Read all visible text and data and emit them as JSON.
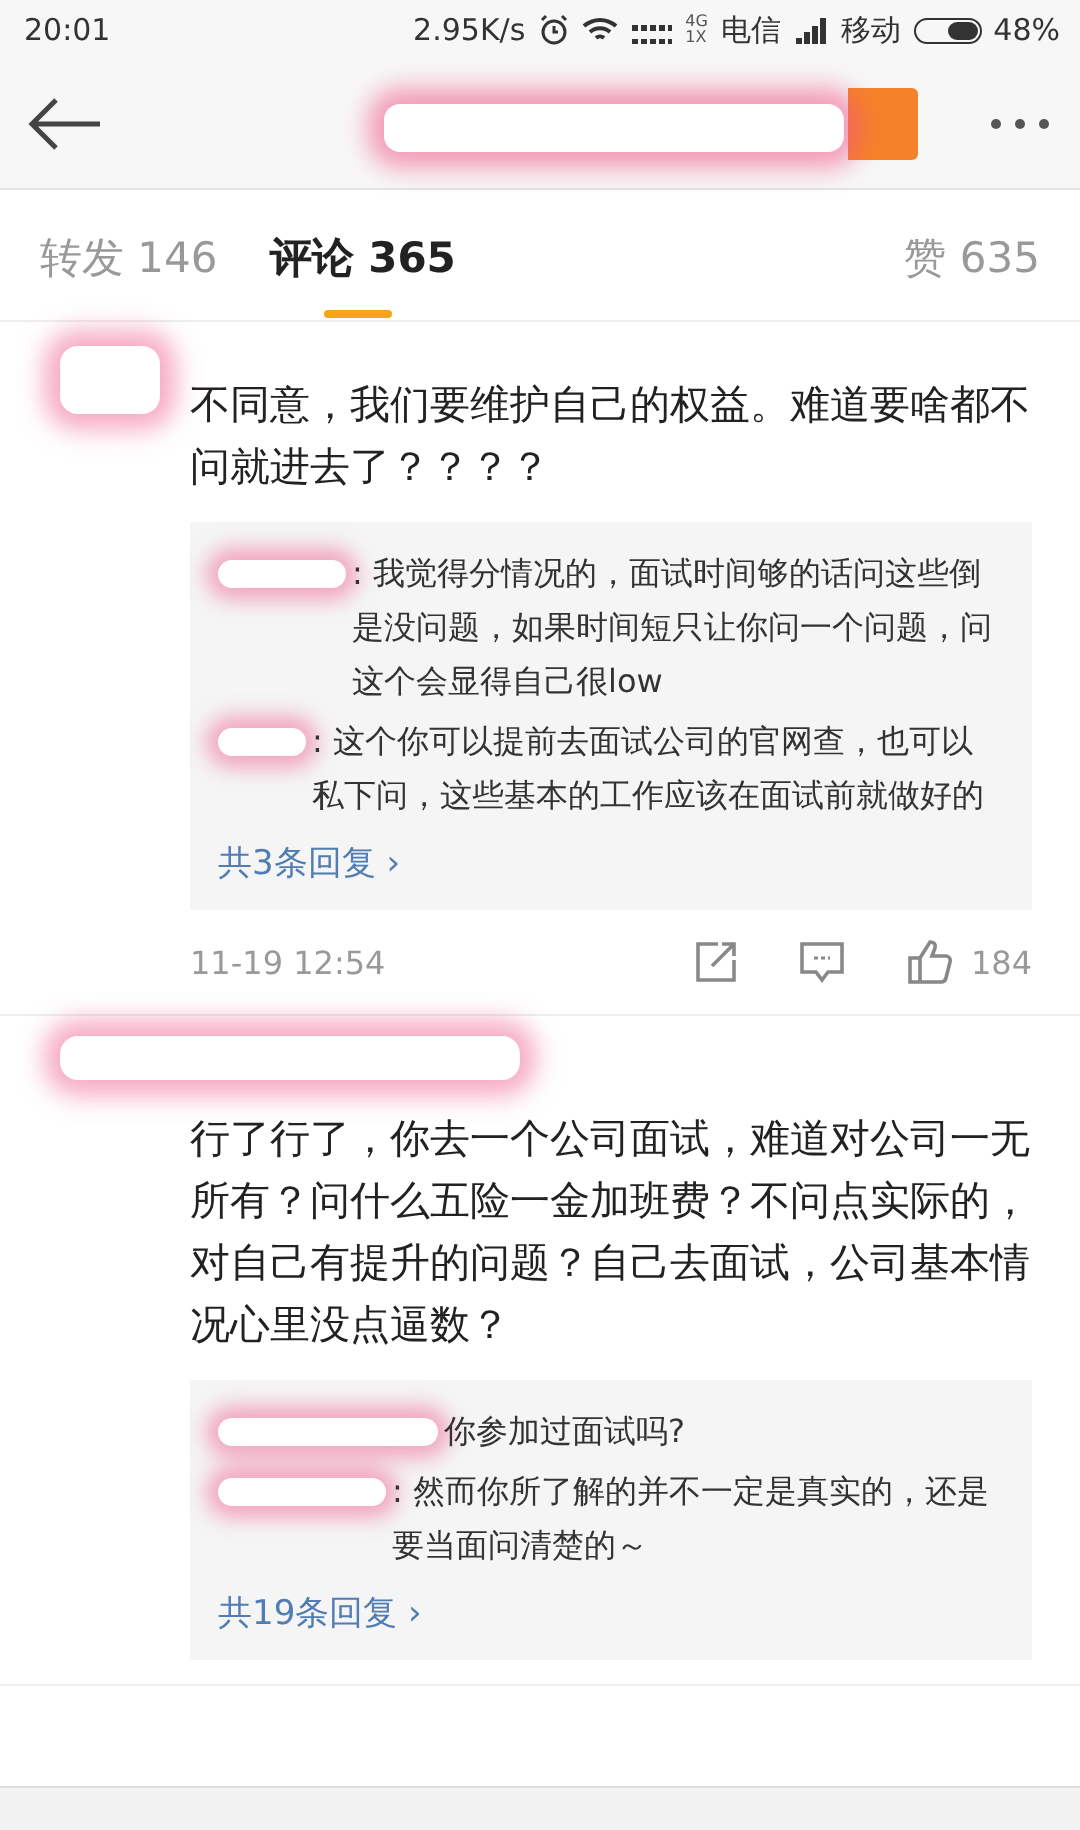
{
  "status_bar": {
    "time": "20:01",
    "speed": "2.95K/s",
    "network_type": "4G 1X",
    "carrier_1": "电信",
    "carrier_2": "移动",
    "battery": "48%"
  },
  "tabs": [
    {
      "label": "转发 146",
      "selected": false
    },
    {
      "label": "评论 365",
      "selected": true
    },
    {
      "label": "赞 635",
      "selected": false
    }
  ],
  "comments": [
    {
      "text": "不同意，我们要维护自己的权益。难道要啥都不问就进去了？？？？",
      "replies": [
        {
          "text": ": 我觉得分情况的，面试时间够的话问这些倒是没问题，如果时间短只让你问一个问题，问这个会显得自己很low"
        },
        {
          "text": ": 这个你可以提前去面试公司的官网查，也可以私下问，这些基本的工作应该在面试前就做好的"
        }
      ],
      "more_replies": "共3条回复 ›",
      "time": "11-19 12:54",
      "likes": "184"
    },
    {
      "text": "行了行了，你去一个公司面试，难道对公司一无所有？问什么五险一金加班费？不问点实际的，对自己有提升的问题？自己去面试，公司基本情况心里没点逼数？",
      "replies": [
        {
          "text": "你参加过面试吗?"
        },
        {
          "text": ": 然而你所了解的并不一定是真实的，还是要当面问清楚的～"
        }
      ],
      "more_replies": "共19条回复 ›"
    }
  ]
}
